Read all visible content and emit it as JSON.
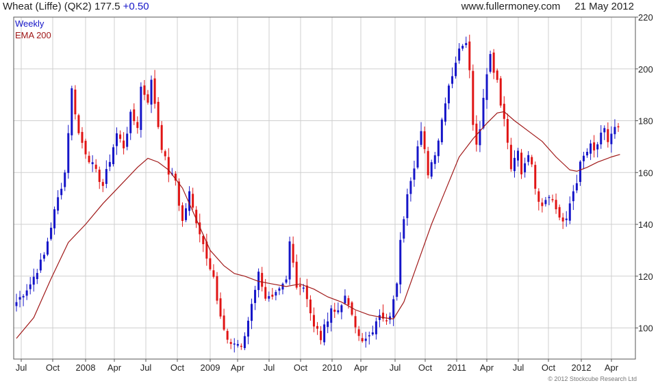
{
  "header": {
    "symbol": "Wheat (Liffe) (QK2)",
    "price": "177.5",
    "change": "+0.50",
    "site": "www.fullermoney.com",
    "date": "21 May 2012"
  },
  "copyright": "© 2012 Stockcube Research Ltd",
  "colors": {
    "up_candle": "#1515c8",
    "down_candle": "#e01414",
    "ema_line": "#a01818",
    "grid": "#cfcfcf",
    "frame": "#555555"
  },
  "chart_data": {
    "type": "candlestick",
    "interval_label": "Weekly",
    "overlay_label": "EMA 200",
    "y_range": [
      88,
      220
    ],
    "y_ticks": [
      100,
      120,
      140,
      160,
      180,
      200,
      220
    ],
    "y_axis_side": "right",
    "grid": true,
    "legend_position": "top-left",
    "x_ticks": [
      "Jul",
      "Oct",
      "2008",
      "Apr",
      "Jul",
      "Oct",
      "2009",
      "Apr",
      "Jul",
      "Oct",
      "2010",
      "Apr",
      "Jul",
      "Oct",
      "2011",
      "Apr",
      "Jul",
      "Oct",
      "2012",
      "Apr"
    ],
    "close_path": [
      [
        0,
        110
      ],
      [
        4,
        117
      ],
      [
        8,
        128
      ],
      [
        11,
        145
      ],
      [
        14,
        160
      ],
      [
        16,
        192
      ],
      [
        18,
        175
      ],
      [
        20,
        168
      ],
      [
        23,
        160
      ],
      [
        25,
        155
      ],
      [
        27,
        165
      ],
      [
        29,
        175
      ],
      [
        31,
        170
      ],
      [
        33,
        182
      ],
      [
        35,
        178
      ],
      [
        36,
        193
      ],
      [
        38,
        188
      ],
      [
        39,
        195
      ],
      [
        40,
        187
      ],
      [
        41,
        178
      ],
      [
        42,
        170
      ],
      [
        44,
        160
      ],
      [
        46,
        157
      ],
      [
        47,
        148
      ],
      [
        48,
        141
      ],
      [
        50,
        152
      ],
      [
        51,
        146
      ],
      [
        53,
        137
      ],
      [
        55,
        128
      ],
      [
        57,
        120
      ],
      [
        58,
        110
      ],
      [
        60,
        98
      ],
      [
        62,
        94
      ],
      [
        64,
        94
      ],
      [
        65,
        92
      ],
      [
        66,
        97
      ],
      [
        67,
        103
      ],
      [
        68,
        110
      ],
      [
        70,
        121
      ],
      [
        71,
        117
      ],
      [
        72,
        112
      ],
      [
        74,
        111
      ],
      [
        76,
        114
      ],
      [
        78,
        118
      ],
      [
        79,
        133
      ],
      [
        80,
        125
      ],
      [
        81,
        117
      ],
      [
        83,
        116
      ],
      [
        84,
        112
      ],
      [
        85,
        106
      ],
      [
        86,
        100
      ],
      [
        87,
        99
      ],
      [
        88,
        96
      ],
      [
        89,
        100
      ],
      [
        90,
        104
      ],
      [
        91,
        108
      ],
      [
        92,
        106
      ],
      [
        93,
        107
      ],
      [
        94,
        110
      ],
      [
        95,
        111
      ],
      [
        96,
        109
      ],
      [
        97,
        104
      ],
      [
        98,
        100
      ],
      [
        99,
        97
      ],
      [
        100,
        96
      ],
      [
        101,
        95
      ],
      [
        102,
        96
      ],
      [
        103,
        99
      ],
      [
        104,
        104
      ],
      [
        105,
        106
      ],
      [
        106,
        103
      ],
      [
        107,
        102
      ],
      [
        108,
        104
      ],
      [
        109,
        110
      ],
      [
        110,
        118
      ],
      [
        111,
        133
      ],
      [
        112,
        143
      ],
      [
        113,
        153
      ],
      [
        114,
        158
      ],
      [
        115,
        163
      ],
      [
        116,
        170
      ],
      [
        117,
        175
      ],
      [
        118,
        168
      ],
      [
        119,
        160
      ],
      [
        120,
        164
      ],
      [
        121,
        168
      ],
      [
        122,
        173
      ],
      [
        124,
        188
      ],
      [
        125,
        194
      ],
      [
        126,
        198
      ],
      [
        127,
        203
      ],
      [
        128,
        207
      ],
      [
        129,
        210
      ],
      [
        130,
        211
      ],
      [
        131,
        201
      ],
      [
        132,
        178
      ],
      [
        133,
        172
      ],
      [
        134,
        177
      ],
      [
        135,
        190
      ],
      [
        136,
        198
      ],
      [
        137,
        206
      ],
      [
        138,
        200
      ],
      [
        139,
        195
      ],
      [
        140,
        186
      ],
      [
        141,
        180
      ],
      [
        142,
        172
      ],
      [
        143,
        160
      ],
      [
        144,
        165
      ],
      [
        145,
        168
      ],
      [
        146,
        160
      ],
      [
        147,
        164
      ],
      [
        148,
        168
      ],
      [
        149,
        162
      ],
      [
        150,
        155
      ],
      [
        151,
        150
      ],
      [
        152,
        148
      ],
      [
        153,
        150
      ],
      [
        154,
        152
      ],
      [
        155,
        149
      ],
      [
        156,
        146
      ],
      [
        157,
        143
      ],
      [
        158,
        141
      ],
      [
        159,
        141
      ],
      [
        160,
        148
      ],
      [
        161,
        153
      ],
      [
        162,
        157
      ],
      [
        163,
        163
      ],
      [
        164,
        166
      ],
      [
        165,
        168
      ],
      [
        166,
        170
      ],
      [
        167,
        168
      ],
      [
        168,
        171
      ],
      [
        169,
        174
      ],
      [
        170,
        176
      ],
      [
        171,
        172
      ],
      [
        172,
        175
      ],
      [
        173,
        177
      ],
      [
        174,
        177
      ],
      [
        174.5,
        177.5
      ]
    ],
    "ema_points": [
      [
        0,
        96
      ],
      [
        5,
        104
      ],
      [
        10,
        119
      ],
      [
        15,
        133
      ],
      [
        20,
        140
      ],
      [
        25,
        148
      ],
      [
        30,
        155
      ],
      [
        35,
        162
      ],
      [
        38,
        165.5
      ],
      [
        41,
        164
      ],
      [
        44,
        161
      ],
      [
        48,
        154
      ],
      [
        52,
        142
      ],
      [
        56,
        130
      ],
      [
        60,
        124
      ],
      [
        63,
        121
      ],
      [
        66,
        120
      ],
      [
        70,
        118
      ],
      [
        74,
        117
      ],
      [
        78,
        116
      ],
      [
        82,
        117
      ],
      [
        86,
        115
      ],
      [
        90,
        112
      ],
      [
        94,
        110
      ],
      [
        98,
        107
      ],
      [
        102,
        105
      ],
      [
        106,
        104
      ],
      [
        109,
        103.5
      ],
      [
        112,
        110
      ],
      [
        116,
        125
      ],
      [
        120,
        140
      ],
      [
        124,
        153
      ],
      [
        128,
        166
      ],
      [
        132,
        173
      ],
      [
        136,
        179
      ],
      [
        139,
        183
      ],
      [
        141,
        183.5
      ],
      [
        144,
        180
      ],
      [
        148,
        176
      ],
      [
        152,
        172
      ],
      [
        156,
        166
      ],
      [
        160,
        161
      ],
      [
        162,
        160.5
      ],
      [
        165,
        162
      ],
      [
        168,
        164
      ],
      [
        172,
        166
      ],
      [
        174.5,
        167
      ]
    ]
  }
}
